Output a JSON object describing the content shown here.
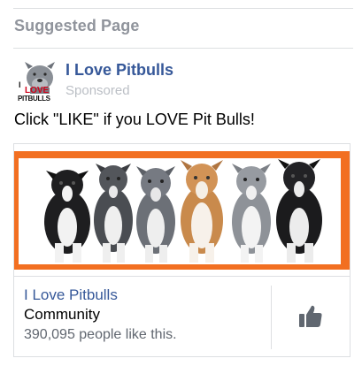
{
  "suggested": {
    "section_title": "Suggested Page"
  },
  "page": {
    "name": "I Love Pitbulls",
    "sponsored_label": "Sponsored",
    "avatar": {
      "logo_word_1": "I",
      "logo_word_2": "LOVE",
      "logo_word_3": "PITBULLS"
    }
  },
  "ad": {
    "text": "Click \"LIKE\" if you LOVE Pit Bulls!",
    "image_icon": "pitbull-puppies-photo"
  },
  "card": {
    "title": "I Love Pitbulls",
    "category": "Community",
    "likes_text": "390,095 people like this.",
    "like_icon": "thumbs-up-icon"
  },
  "colors": {
    "link_blue": "#365899",
    "muted_gray": "#90949c",
    "banner_orange": "#f26f21",
    "like_icon_gray": "#606770"
  }
}
